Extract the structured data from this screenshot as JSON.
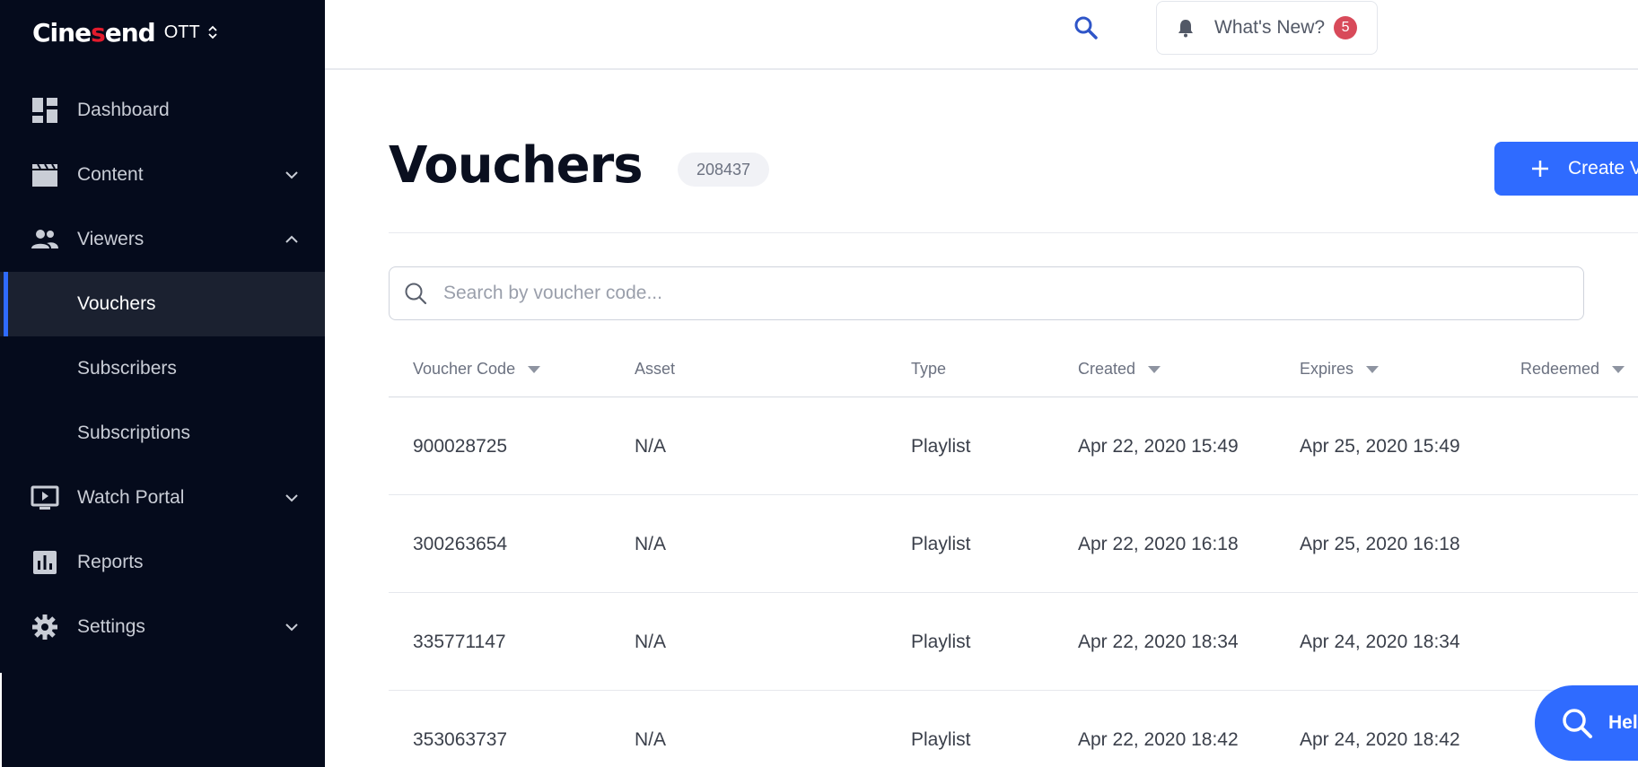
{
  "brand": {
    "logo": "Cinesend",
    "logo_left": "Cine",
    "logo_slash": "s",
    "logo_right": "end",
    "product": "OTT"
  },
  "sidebar": {
    "items": [
      {
        "label": "Dashboard",
        "icon": "dashboard-icon"
      },
      {
        "label": "Content",
        "icon": "clapperboard-icon",
        "expandable": true,
        "expanded": false
      },
      {
        "label": "Viewers",
        "icon": "people-icon",
        "expandable": true,
        "expanded": true
      },
      {
        "label": "Vouchers",
        "sub": true,
        "active": true
      },
      {
        "label": "Subscribers",
        "sub": true
      },
      {
        "label": "Subscriptions",
        "sub": true
      },
      {
        "label": "Watch Portal",
        "icon": "play-screen-icon",
        "expandable": true,
        "expanded": false
      },
      {
        "label": "Reports",
        "icon": "bar-chart-icon"
      },
      {
        "label": "Settings",
        "icon": "gear-icon",
        "expandable": true,
        "expanded": false
      }
    ]
  },
  "header": {
    "whats_new_label": "What's New?",
    "whats_new_count": "5"
  },
  "main": {
    "title": "Vouchers",
    "count": "208437",
    "create_button_label": "Create V",
    "search_placeholder": "Search by voucher code..."
  },
  "table": {
    "columns": [
      "Voucher Code",
      "Asset",
      "Type",
      "Created",
      "Expires",
      "Redeemed"
    ],
    "rows": [
      {
        "code": "900028725",
        "asset": "N/A",
        "type": "Playlist",
        "created": "Apr 22, 2020 15:49",
        "expires": "Apr 25, 2020 15:49"
      },
      {
        "code": "300263654",
        "asset": "N/A",
        "type": "Playlist",
        "created": "Apr 22, 2020 16:18",
        "expires": "Apr 25, 2020 16:18"
      },
      {
        "code": "335771147",
        "asset": "N/A",
        "type": "Playlist",
        "created": "Apr 22, 2020 18:34",
        "expires": "Apr 24, 2020 18:34"
      },
      {
        "code": "353063737",
        "asset": "N/A",
        "type": "Playlist",
        "created": "Apr 22, 2020 18:42",
        "expires": "Apr 24, 2020 18:42"
      }
    ]
  },
  "help": {
    "label": "Hel"
  },
  "colors": {
    "sidebar_bg": "#050b1c",
    "accent": "#2f6bff",
    "badge": "#d84a5a"
  }
}
